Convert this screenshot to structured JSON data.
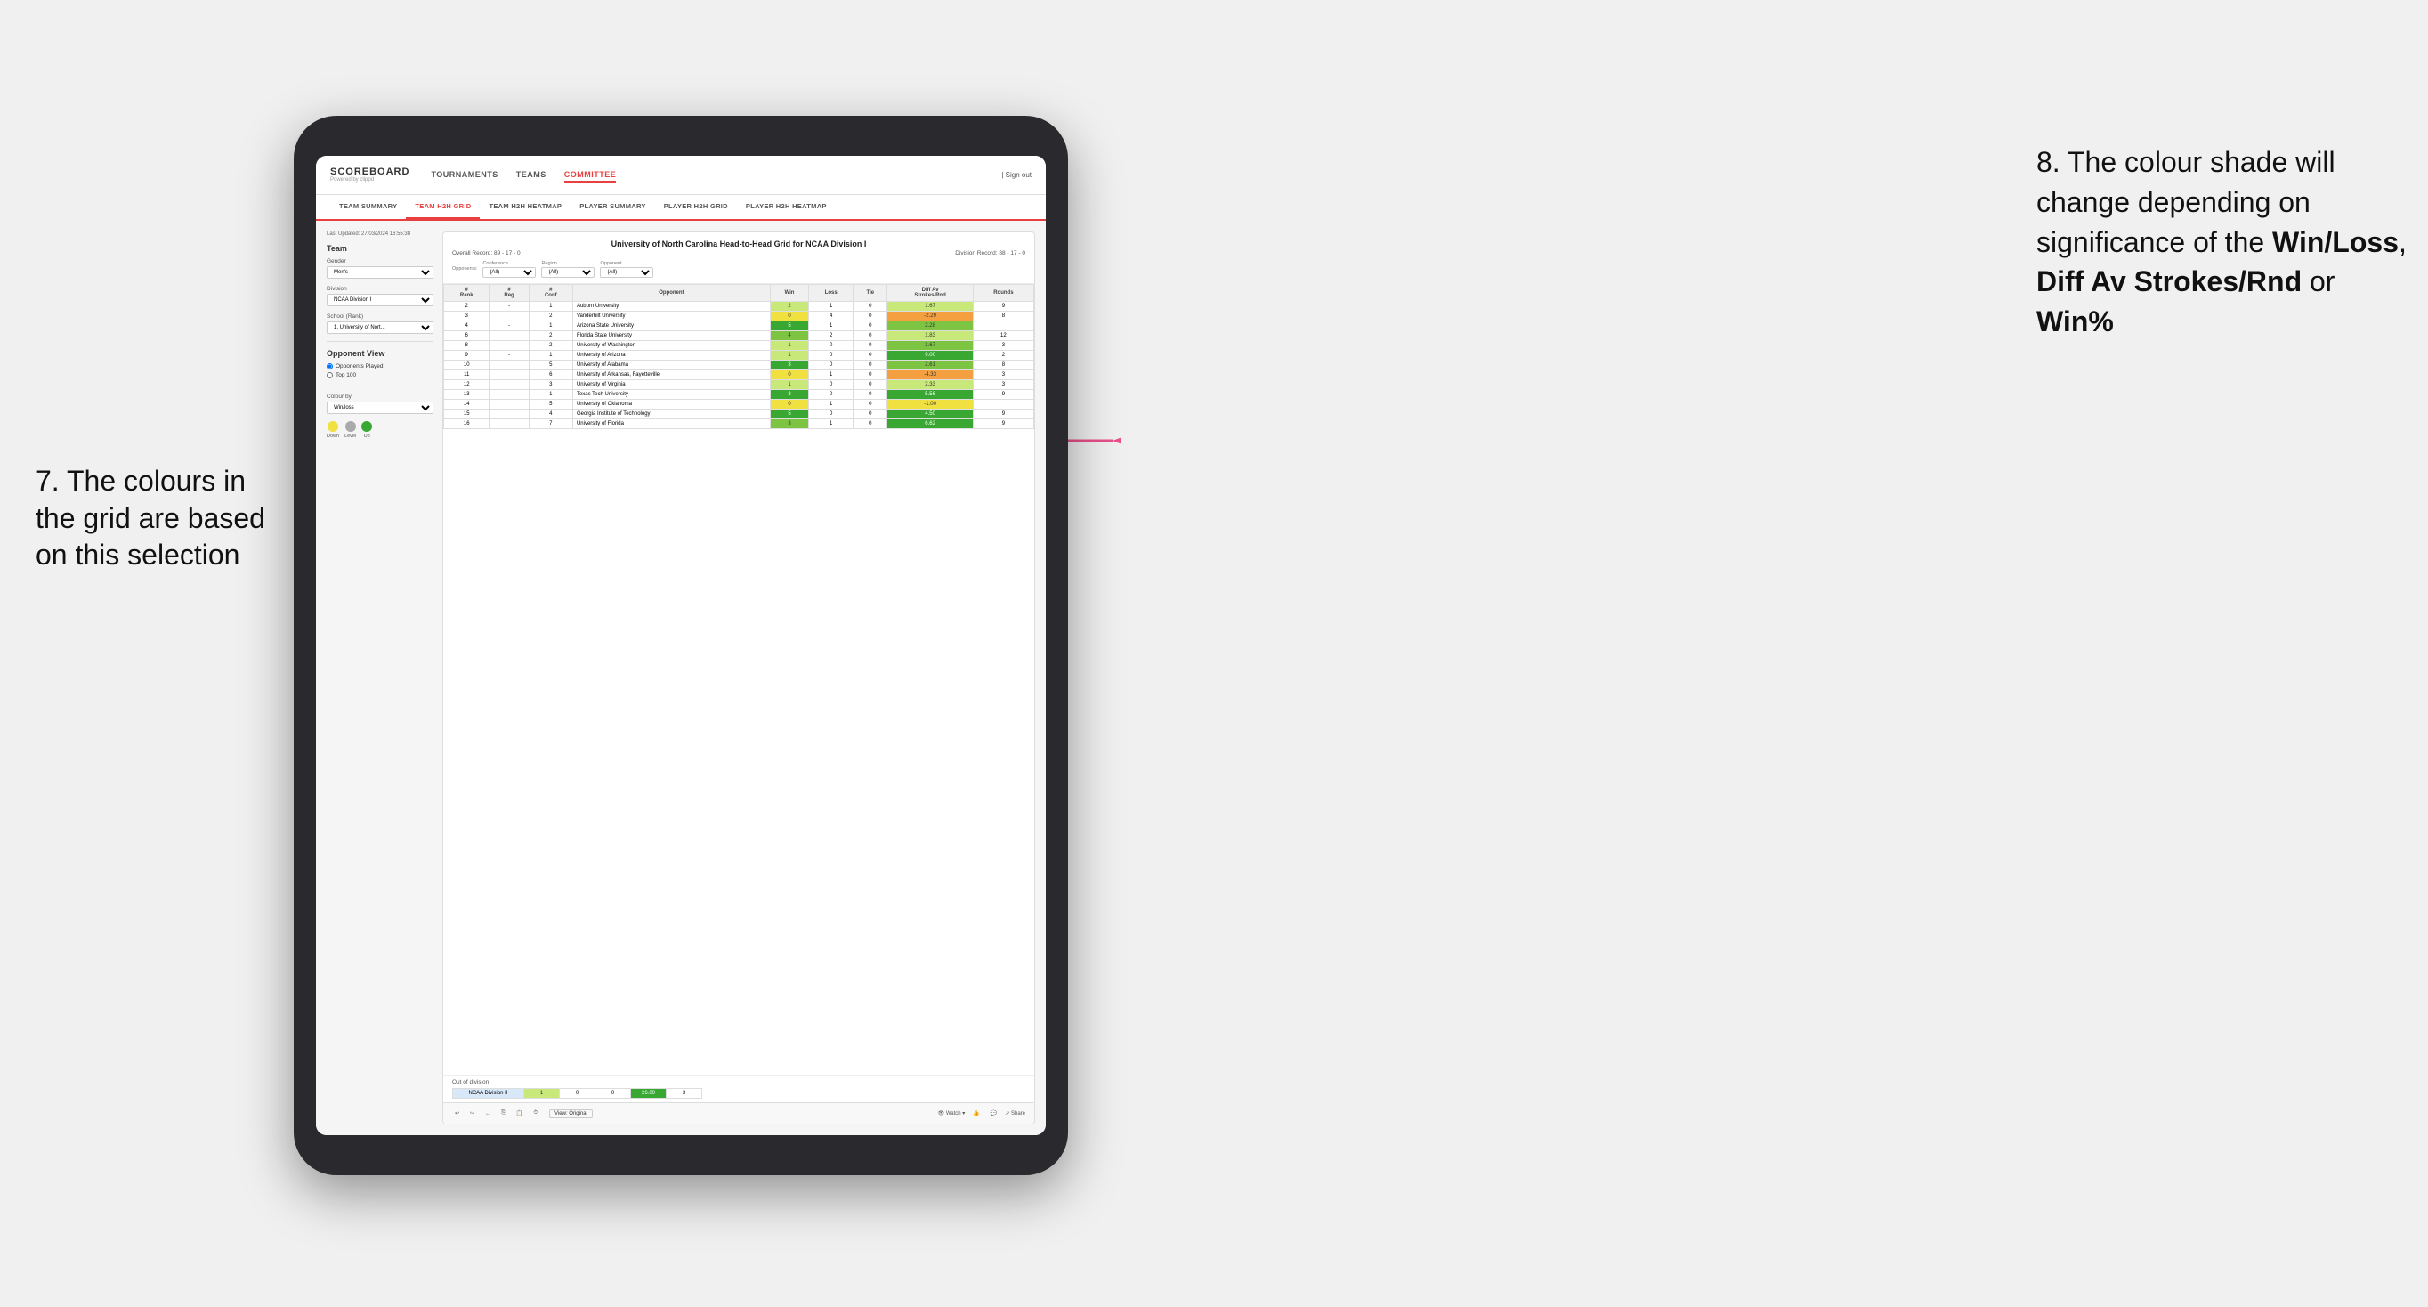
{
  "annotations": {
    "left_number": "7.",
    "left_text": "The colours in the grid are based on this selection",
    "right_number": "8.",
    "right_text_before": " The colour shade will change depending on significance of the ",
    "right_bold1": "Win/Loss",
    "right_text2": ", ",
    "right_bold2": "Diff Av Strokes/Rnd",
    "right_text3": " or ",
    "right_bold3": "Win%"
  },
  "nav": {
    "logo": "SCOREBOARD",
    "logo_sub": "Powered by clippd",
    "items": [
      "TOURNAMENTS",
      "TEAMS",
      "COMMITTEE"
    ],
    "active_item": "COMMITTEE",
    "sign_out": "Sign out"
  },
  "sub_nav": {
    "items": [
      "TEAM SUMMARY",
      "TEAM H2H GRID",
      "TEAM H2H HEATMAP",
      "PLAYER SUMMARY",
      "PLAYER H2H GRID",
      "PLAYER H2H HEATMAP"
    ],
    "active_item": "TEAM H2H GRID"
  },
  "sidebar": {
    "timestamp": "Last Updated: 27/03/2024 16:55:38",
    "team_label": "Team",
    "gender_label": "Gender",
    "gender_value": "Men's",
    "division_label": "Division",
    "division_value": "NCAA Division I",
    "school_rank_label": "School (Rank)",
    "school_value": "1. University of Nort...",
    "opponent_view_label": "Opponent View",
    "radio_options": [
      "Opponents Played",
      "Top 100"
    ],
    "active_radio": "Opponents Played",
    "colour_by_label": "Colour by",
    "colour_by_value": "Win/loss",
    "legend": {
      "down_label": "Down",
      "level_label": "Level",
      "up_label": "Up",
      "down_color": "#f0e040",
      "level_color": "#aaaaaa",
      "up_color": "#38a832"
    }
  },
  "grid": {
    "title": "University of North Carolina Head-to-Head Grid for NCAA Division I",
    "overall_record": "Overall Record: 89 - 17 - 0",
    "division_record": "Division Record: 88 - 17 - 0",
    "filters": {
      "opponents_label": "Opponents:",
      "opponents_value": "(All)",
      "conference_label": "Conference",
      "conference_value": "(All)",
      "region_label": "Region",
      "region_value": "(All)",
      "opponent_label": "Opponent",
      "opponent_value": "(All)"
    },
    "columns": [
      "#\nRank",
      "#\nReg",
      "#\nConf",
      "Opponent",
      "Win",
      "Loss",
      "Tie",
      "Diff Av\nStrokes/Rnd",
      "Rounds"
    ],
    "rows": [
      {
        "rank": "2",
        "reg": "-",
        "conf": "1",
        "opponent": "Auburn University",
        "win": "2",
        "loss": "1",
        "tie": "0",
        "diff": "1.67",
        "rounds": "9",
        "win_color": "green-light",
        "diff_color": "green-light"
      },
      {
        "rank": "3",
        "reg": "",
        "conf": "2",
        "opponent": "Vanderbilt University",
        "win": "0",
        "loss": "4",
        "tie": "0",
        "diff": "-2.29",
        "rounds": "8",
        "win_color": "yellow",
        "diff_color": "red-light"
      },
      {
        "rank": "4",
        "reg": "-",
        "conf": "1",
        "opponent": "Arizona State University",
        "win": "5",
        "loss": "1",
        "tie": "0",
        "diff": "2.28",
        "rounds": "",
        "win_color": "green-dark",
        "diff_color": "green-mid"
      },
      {
        "rank": "6",
        "reg": "",
        "conf": "2",
        "opponent": "Florida State University",
        "win": "4",
        "loss": "2",
        "tie": "0",
        "diff": "1.83",
        "rounds": "12",
        "win_color": "green-mid",
        "diff_color": "green-light"
      },
      {
        "rank": "8",
        "reg": "",
        "conf": "2",
        "opponent": "University of Washington",
        "win": "1",
        "loss": "0",
        "tie": "0",
        "diff": "3.67",
        "rounds": "3",
        "win_color": "green-light",
        "diff_color": "green-mid"
      },
      {
        "rank": "9",
        "reg": "-",
        "conf": "1",
        "opponent": "University of Arizona",
        "win": "1",
        "loss": "0",
        "tie": "0",
        "diff": "9.00",
        "rounds": "2",
        "win_color": "green-light",
        "diff_color": "green-dark"
      },
      {
        "rank": "10",
        "reg": "",
        "conf": "5",
        "opponent": "University of Alabama",
        "win": "3",
        "loss": "0",
        "tie": "0",
        "diff": "2.61",
        "rounds": "8",
        "win_color": "green-dark",
        "diff_color": "green-mid"
      },
      {
        "rank": "11",
        "reg": "",
        "conf": "6",
        "opponent": "University of Arkansas, Fayetteville",
        "win": "0",
        "loss": "1",
        "tie": "0",
        "diff": "-4.33",
        "rounds": "3",
        "win_color": "yellow",
        "diff_color": "red-light"
      },
      {
        "rank": "12",
        "reg": "",
        "conf": "3",
        "opponent": "University of Virginia",
        "win": "1",
        "loss": "0",
        "tie": "0",
        "diff": "2.33",
        "rounds": "3",
        "win_color": "green-light",
        "diff_color": "green-light"
      },
      {
        "rank": "13",
        "reg": "-",
        "conf": "1",
        "opponent": "Texas Tech University",
        "win": "3",
        "loss": "0",
        "tie": "0",
        "diff": "5.56",
        "rounds": "9",
        "win_color": "green-dark",
        "diff_color": "green-dark"
      },
      {
        "rank": "14",
        "reg": "",
        "conf": "5",
        "opponent": "University of Oklahoma",
        "win": "0",
        "loss": "1",
        "tie": "0",
        "diff": "-1.00",
        "rounds": "",
        "win_color": "yellow",
        "diff_color": "yellow"
      },
      {
        "rank": "15",
        "reg": "",
        "conf": "4",
        "opponent": "Georgia Institute of Technology",
        "win": "5",
        "loss": "0",
        "tie": "0",
        "diff": "4.50",
        "rounds": "9",
        "win_color": "green-dark",
        "diff_color": "green-dark"
      },
      {
        "rank": "16",
        "reg": "",
        "conf": "7",
        "opponent": "University of Florida",
        "win": "3",
        "loss": "1",
        "tie": "0",
        "diff": "6.62",
        "rounds": "9",
        "win_color": "green-mid",
        "diff_color": "green-dark"
      }
    ],
    "out_of_division": {
      "label": "Out of division",
      "name": "NCAA Division II",
      "win": "1",
      "loss": "0",
      "tie": "0",
      "diff": "26.00",
      "rounds": "3"
    }
  },
  "toolbar": {
    "view_label": "View: Original",
    "watch_label": "Watch",
    "share_label": "Share"
  }
}
